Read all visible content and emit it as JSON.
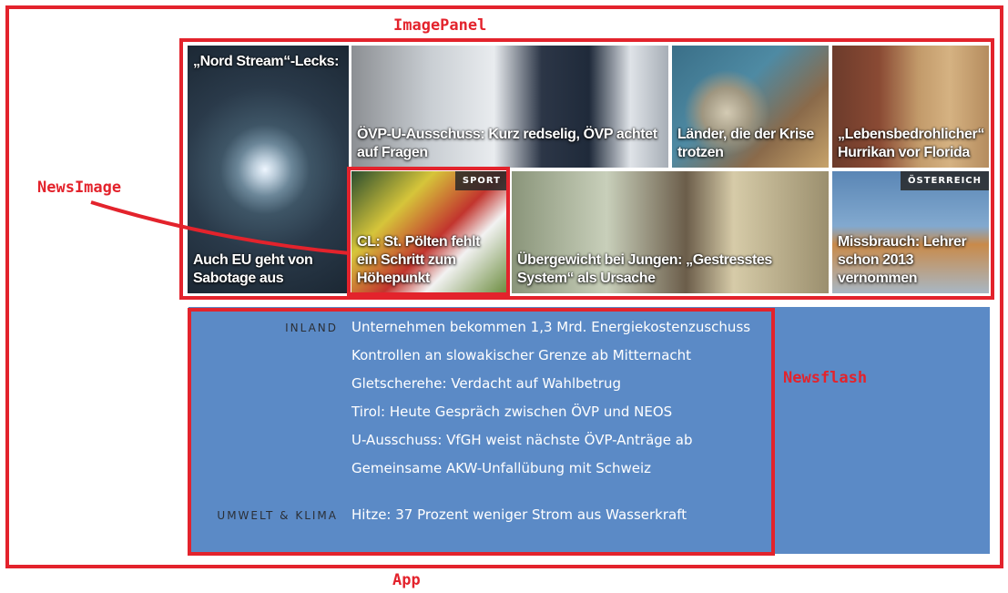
{
  "annotations": {
    "app": "App",
    "image_panel": "ImagePanel",
    "news_image": "NewsImage",
    "newsflash": "Newsflash"
  },
  "colors": {
    "annotation_red": "#e3232c",
    "newsflash_blue": "#5b8ac6"
  },
  "tiles": [
    {
      "id": "nordstream",
      "caption_top": "„Nord Stream“-Lecks:",
      "caption": "Auch EU geht von Sabotage aus",
      "tag": ""
    },
    {
      "id": "kurz",
      "caption": "ÖVP-U-Ausschuss: Kurz redselig, ÖVP achtet auf Fragen",
      "tag": ""
    },
    {
      "id": "krise",
      "caption": "Länder, die der Krise trotzen",
      "tag": ""
    },
    {
      "id": "florida",
      "caption": "„Lebensbedrohlicher“ Hurrikan vor Florida",
      "tag": ""
    },
    {
      "id": "sport",
      "caption": "CL: St. Pölten fehlt ein Schritt zum Höhepunkt",
      "tag": "SPORT"
    },
    {
      "id": "obesity",
      "caption": "Übergewicht bei Jungen: „Gestresstes System“ als Ursache",
      "tag": ""
    },
    {
      "id": "abuse",
      "caption": "Missbrauch: Lehrer schon 2013 vernommen",
      "tag": "ÖSTERREICH"
    }
  ],
  "newsflash": [
    {
      "category": "INLAND",
      "items": [
        "Unternehmen bekommen 1,3 Mrd. Energiekostenzuschuss",
        "Kontrollen an slowakischer Grenze ab Mitternacht",
        "Gletscherehe: Verdacht auf Wahlbetrug",
        "Tirol: Heute Gespräch zwischen ÖVP und NEOS",
        "U-Ausschuss: VfGH weist nächste ÖVP-Anträge ab",
        "Gemeinsame AKW-Unfallübung mit Schweiz"
      ]
    },
    {
      "category": "UMWELT & KLIMA",
      "items": [
        "Hitze: 37 Prozent weniger Strom aus Wasserkraft"
      ]
    }
  ]
}
